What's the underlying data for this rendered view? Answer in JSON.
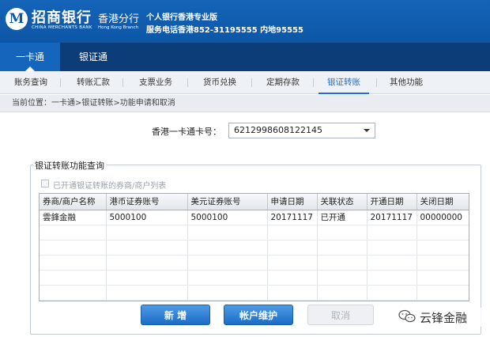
{
  "header": {
    "brand_cn": "招商银行",
    "brand_en": "CHINA MERCHANTS BANK",
    "branch_cn": "香港分行",
    "branch_en": "Hong Kong Branch",
    "tagline": "个人银行香港专业版",
    "hotline": "服务电话香港852-31195555 内地95555",
    "logo_glyph": "M"
  },
  "main_tabs": [
    {
      "label": "一卡通",
      "active": true
    },
    {
      "label": "银证通",
      "active": false
    }
  ],
  "sub_tabs": [
    {
      "label": "账务查询"
    },
    {
      "label": "转账汇款"
    },
    {
      "label": "支票业务"
    },
    {
      "label": "货币兑换"
    },
    {
      "label": "定期存款"
    },
    {
      "label": "银证转账",
      "active": true
    },
    {
      "label": "其他功能"
    }
  ],
  "breadcrumb": "当前位置：一卡通>银证转账>功能申请和取消",
  "card_field": {
    "label": "香港一卡通卡号：",
    "value": "6212998608122145"
  },
  "section": {
    "legend": "银证转账功能查询",
    "checkbox_label": "已开通银证转账的券商/商户列表",
    "checkbox_checked": false
  },
  "table": {
    "columns": [
      "券商/商户名称",
      "港币证券账号",
      "美元证券账号",
      "申请日期",
      "关联状态",
      "开通日期",
      "关闭日期"
    ],
    "rows": [
      [
        "雲鋒金融",
        "5000100",
        "5000100",
        "20171117",
        "已开通",
        "20171117",
        "00000000"
      ]
    ]
  },
  "buttons": {
    "add": "新 增",
    "maintain": "帐户维护",
    "cancel": "取消"
  },
  "watermark": {
    "icon": "wechat-icon",
    "text": "云锋金融"
  },
  "colors": {
    "header_blue": "#1464b8",
    "tabbar_navy": "#0c3d78",
    "active_tab": "#1565bd",
    "accent": "#1a6fd1"
  }
}
